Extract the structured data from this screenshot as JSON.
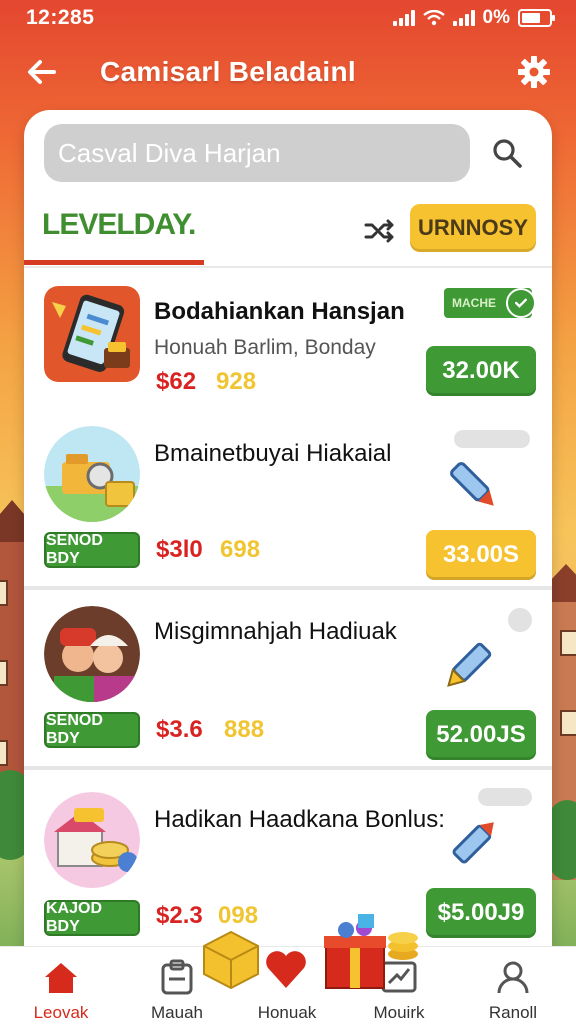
{
  "status_bar": {
    "time": "12:285",
    "battery": "0%"
  },
  "header": {
    "title": "Camisarl Beladainl"
  },
  "search": {
    "value": "Casval Diva Harjan"
  },
  "level": {
    "title": "LEVELDAY.",
    "button_label": "URNNOSY"
  },
  "items": [
    {
      "name": "Bodahiankan Hansjan",
      "subtitle": "Honuah Barlim, Bonday",
      "price": "$62",
      "price_alt": "928",
      "badge": "MACHE",
      "amount": "32.00K"
    },
    {
      "name": "Bmainetbuyai Hiakaial",
      "tag": "SENOD BDY",
      "price": "$3l0",
      "price_alt": "698",
      "amount": "33.00S"
    },
    {
      "name": "Misgimnahjah Hadiuak",
      "tag": "SENOD BDY",
      "price": "$3.6",
      "price_alt": "888",
      "amount": "52.00JS"
    },
    {
      "name": "Hadikan Haadkana Bonlus:",
      "tag": "KAJOD BDY",
      "price": "$2.3",
      "price_alt": "098",
      "amount": "$5.00J9"
    }
  ],
  "nav": [
    {
      "label": "Leovak",
      "icon": "home-icon"
    },
    {
      "label": "Mauah",
      "icon": "briefcase-icon"
    },
    {
      "label": "Honuak",
      "icon": "heart-icon"
    },
    {
      "label": "Mouirk",
      "icon": "chart-icon"
    },
    {
      "label": "Ranoll",
      "icon": "profile-icon"
    }
  ],
  "colors": {
    "primary_red": "#e4472f",
    "green": "#3f9a36",
    "yellow": "#f7c230",
    "price_red": "#d92323"
  }
}
